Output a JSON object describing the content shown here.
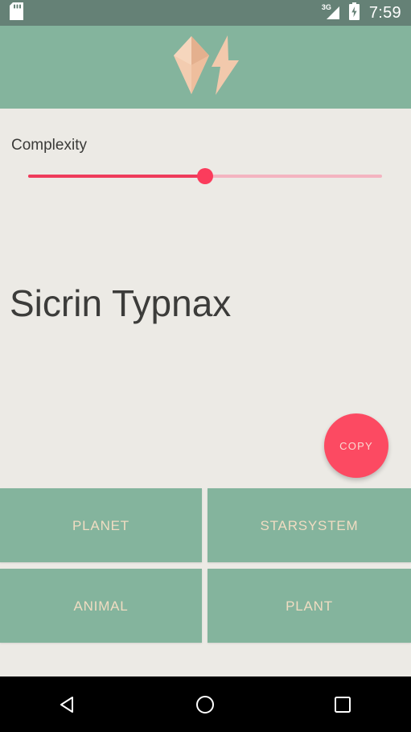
{
  "status_bar": {
    "sd_card_icon": "sd-card-icon",
    "network_label": "3G",
    "signal_icon": "signal-bars-icon",
    "battery_icon": "battery-charging-icon",
    "time": "7:59",
    "background_color": "#658176",
    "foreground_color": "#ffffff"
  },
  "header": {
    "logo_icon": "gem-lightning-logo-icon",
    "background_color": "#84B49D",
    "logo_color": "#F2C9AC",
    "logo_shadow_color": "#E0B193"
  },
  "complexity": {
    "label": "Complexity",
    "value_percent": 50,
    "track_color": "#F4B4C0",
    "fill_color": "#EF3B5B",
    "thumb_color": "#FB3C5C"
  },
  "result": {
    "generated_name": "Sicrin Typnax",
    "text_color": "#3C3C3A"
  },
  "copy_button": {
    "label": "COPY",
    "background_color": "#FC4A62",
    "label_color": "#FBD9D2"
  },
  "categories": {
    "background_color": "#84B49D",
    "label_color": "#F0DCC2",
    "items": [
      {
        "label": "PLANET"
      },
      {
        "label": "STARSYSTEM"
      },
      {
        "label": "ANIMAL"
      },
      {
        "label": "PLANT"
      }
    ]
  },
  "nav_bar": {
    "background_color": "#000000",
    "back_icon": "back-triangle-icon",
    "home_icon": "home-circle-icon",
    "recents_icon": "recents-square-icon"
  },
  "page": {
    "background_color": "#ECEAE5"
  }
}
